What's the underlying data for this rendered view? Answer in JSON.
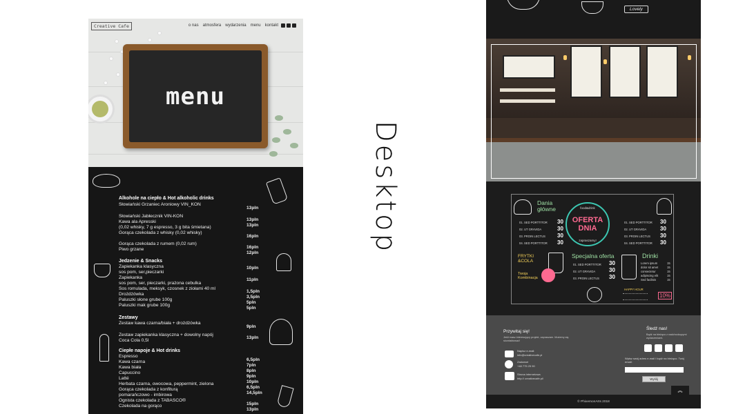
{
  "left": {
    "logo": "Creative Cafe",
    "nav": [
      "o nas",
      "atmosfera",
      "wydarzenia",
      "menu",
      "kontakt"
    ],
    "board_word": "menu",
    "sections": [
      {
        "title": "Alkohole na ciepło & Hot alkoholic drinks",
        "items": [
          "Słowiański Grzaniec Aroniowy VIN_KON",
          "Słowiański Jabłecznik VIN-KON",
          "Kawa ala Apresski",
          "(0,02 whisky, 7 g espresso, 3 g bita śmietana)",
          "Gorąca czekolada z whisky (0,02 whisky)",
          "Gorąca czekolada z rumem (0,02 rum)",
          "Piwo grzane"
        ],
        "prices": [
          "13pln",
          "13pln",
          "13pln",
          "16pln",
          "16pln",
          "12pln"
        ]
      },
      {
        "title": "Jedzenie & Snacks",
        "items": [
          "Zapiekanka klasyczna",
          "sos pom, ser,pieczarki",
          "Zapiekanka",
          "sos pom, ser, pieczarki, prażona cebulka",
          "Sos romulada, meksyk, czosnek z ziołami 40 ml",
          "Drożdżówka",
          "Paluszki słone grube 100g",
          "Paluszki mak grube 100g"
        ],
        "prices": [
          "10pln",
          "11pln",
          "1,5pln",
          "3,5pln",
          "5pln",
          "5pln"
        ]
      },
      {
        "title": "Zestawy",
        "items": [
          "Zestaw kawa czarna/biała + drożdżówka",
          "Zestaw zapiekanka klasyczna + dowolny napój",
          "Coca Cola 0,5l"
        ],
        "prices": [
          "9pln",
          "13pln"
        ]
      },
      {
        "title": "Ciepłe napoje & Hot drinks",
        "items": [
          "Espresso",
          "Kawa czarna",
          "Kawa biała",
          "Capuccino",
          "Latté",
          "Herbata czarna, owocowa, peppermint, zielona",
          "Gorąca czekolada z konfiturą",
          "pomarańczowo - imbirowa",
          "Ognista czekolada z TABASCO®",
          "Czekolada na gorąco"
        ],
        "prices": [
          "6,5pln",
          "7pln",
          "8pln",
          "9pln",
          "10pln",
          "6,5pln",
          "14,5pln",
          "15pln",
          "13pln"
        ]
      }
    ]
  },
  "vertical_title": "Desktop",
  "right": {
    "top_banner": "Lovely",
    "board": {
      "dania_title": "Dania główne",
      "dania_items": [
        "01. SED PORTTITOR",
        "02. UT GRAVIDA",
        "03. PROIN LECTUS",
        "04. SED PORTTITOR"
      ],
      "dania_prices": [
        "30",
        "30",
        "30",
        "30"
      ],
      "food_drink": "food&drink",
      "oferta_line1": "OFERTA",
      "oferta_line2": "DNIA",
      "zapraszamy": "zapraszamy!",
      "right_items": [
        "01. SED PORTTITOR",
        "02. UT GRAVIDA",
        "03. PROIN LECTUS",
        "04. SED PORTTITOR"
      ],
      "right_prices": [
        "30",
        "30",
        "30",
        "30"
      ],
      "frytki_title": "FRYTKI &COLA",
      "twoja": "Twoja Kombinacja",
      "specjalna_title": "Specjalna oferta",
      "spec_items": [
        "01. SED PORTTITOR",
        "02. UT GRAVIDA",
        "03. PROIN LECTUS"
      ],
      "spec_prices": [
        "30",
        "30",
        "30"
      ],
      "drinki_title": "Drinki",
      "drinki_items": [
        "Lorem ipsum",
        "dolor sit amet",
        "consectetur",
        "adipiscing elit",
        "Sed facilisis"
      ],
      "drinki_prices": [
        "15",
        "15",
        "15",
        "15",
        "15"
      ],
      "happy_hour": "HAPPY HOUR",
      "discount": "10%"
    },
    "footer": {
      "welcome": "Przywitaj się!",
      "desc": "Jeśli masz interesujący projekt, zapraszam. Możemy się skontaktować!",
      "email_label": "Napisz e-mail:",
      "email": "info@creativecafe.pl",
      "phone_label": "Zadzwoń",
      "phone": "+48 775 25 90",
      "web_label": "Strona internetowa",
      "web": "http:// creativecafe.pl/",
      "follow": "Śledź nas!",
      "follow_desc": "Bądź na bieżąco z nadchodzącymi wydarzeniami.",
      "newsletter": "Wpisz swój adres e-mail i bądź na bieżąco. Twój email:",
      "send": "Wyślij",
      "up": "︽"
    },
    "copyright": "© PhixemonArts 2018"
  }
}
